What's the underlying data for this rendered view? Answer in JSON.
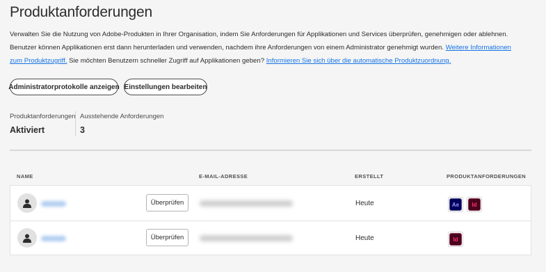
{
  "page": {
    "title": "Produktanforderungen",
    "description_prefix": "Verwalten Sie die Nutzung von Adobe-Produkten in Ihrer Organisation, indem Sie Anforderungen für Applikationen und Services überprüfen, genehmigen oder ablehnen. Benutzer können Applikationen erst dann herunterladen und verwenden, nachdem ihre Anforderungen von einem Administrator genehmigt wurden.",
    "link1": "Weitere Informationen zum Produktzugriff.",
    "description_mid": "Sie möchten Benutzern schneller Zugriff auf Applikationen geben?",
    "link2": "Informieren Sie sich über die automatische Produktzuordnung."
  },
  "actions": {
    "logs_button": "Administratorprotokolle anzeigen",
    "settings_button": "Einstellungen bearbeiten"
  },
  "stats": {
    "requests_label": "Produktanforderungen",
    "requests_value": "Aktiviert",
    "pending_label": "Ausstehende Anforderungen",
    "pending_value": "3"
  },
  "table": {
    "headers": {
      "name": "NAME",
      "email": "E-MAIL-ADRESSE",
      "created": "ERSTELLT",
      "products": "PRODUKTANFORDERUNGEN"
    },
    "review_label": "Überprüfen",
    "rows": [
      {
        "created": "Heute",
        "apps": [
          "Ae",
          "Id"
        ]
      },
      {
        "created": "Heute",
        "apps": [
          "Id"
        ]
      }
    ]
  },
  "colors": {
    "link": "#1473e6",
    "ae_bg": "#00005b",
    "id_bg": "#49021f"
  },
  "icons": {
    "avatar": "user-icon",
    "after_effects": "after-effects-icon",
    "indesign": "indesign-icon"
  }
}
